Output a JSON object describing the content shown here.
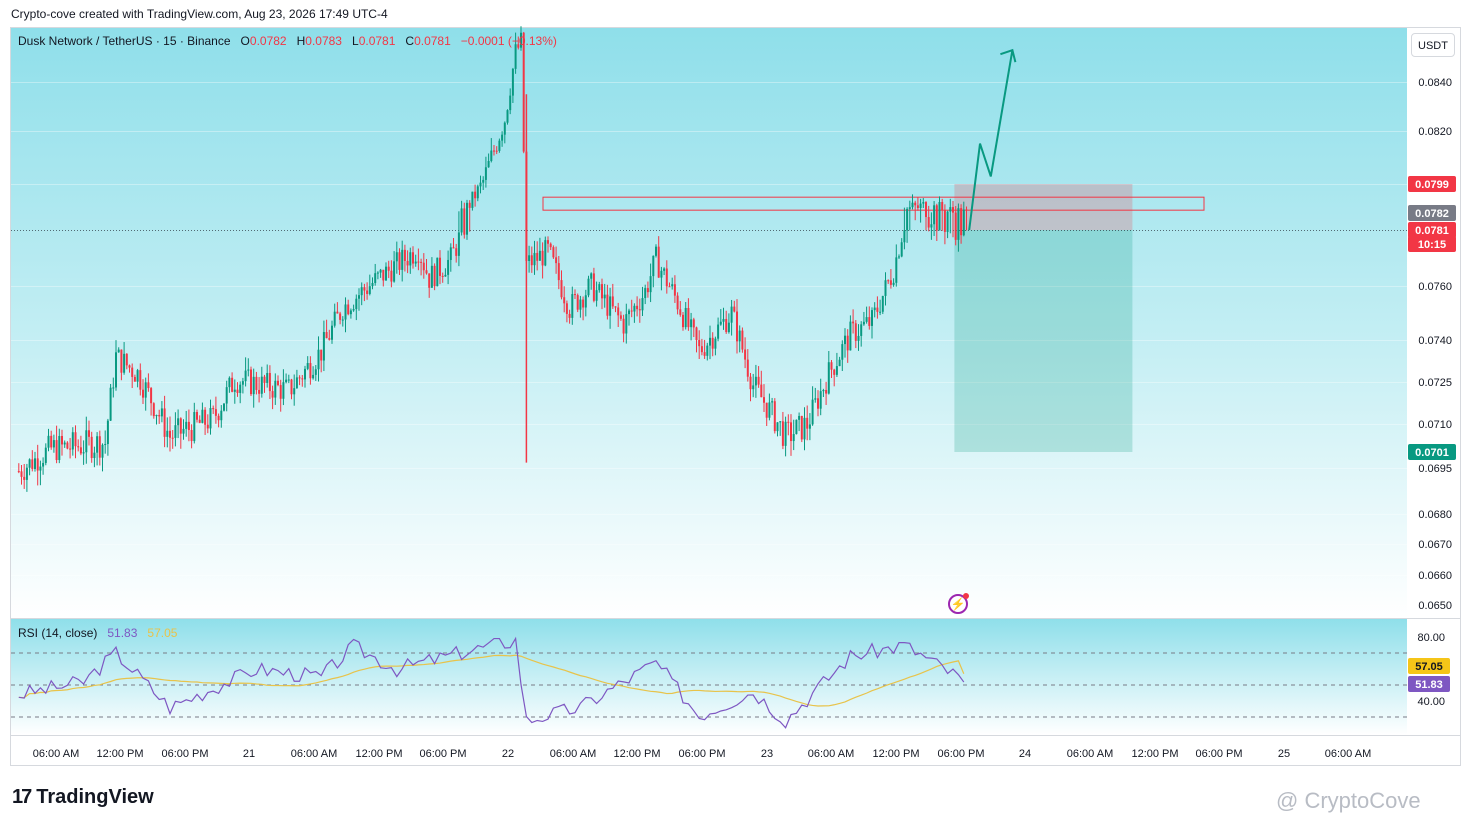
{
  "header": {
    "caption": "Crypto-cove created with TradingView.com, Aug 23, 2026 17:49 UTC-4"
  },
  "legend": {
    "symbol": "Dusk Network / TetherUS · 15 · Binance",
    "o_label": "O",
    "o": "0.0782",
    "h_label": "H",
    "h": "0.0783",
    "l_label": "L",
    "l": "0.0781",
    "c_label": "C",
    "c": "0.0781",
    "change": "−0.0001 (−0.13%)"
  },
  "currency_button": "USDT",
  "price_axis": {
    "ticks": [
      "0.0840",
      "0.0820",
      "0.0760",
      "0.0740",
      "0.0725",
      "0.0710",
      "0.0695",
      "0.0680",
      "0.0670",
      "0.0660",
      "0.0650"
    ],
    "tags": [
      {
        "label": "0.0799",
        "color": "#f23645"
      },
      {
        "label": "0.0782",
        "color": "#787b86"
      },
      {
        "label": "0.0781",
        "color": "#f23645"
      },
      {
        "label": "10:15",
        "color": "#f23645"
      },
      {
        "label": "0.0701",
        "color": "#089981"
      }
    ]
  },
  "rsi": {
    "title": "RSI (14, close)",
    "value": "51.83",
    "ma": "57.05",
    "ticks": [
      "80.00",
      "40.00"
    ],
    "tags": [
      {
        "label": "57.05",
        "color": "#f5c518"
      },
      {
        "label": "51.83",
        "color": "#7e57c2"
      }
    ]
  },
  "time_axis": {
    "labels": [
      "06:00 AM",
      "12:00 PM",
      "06:00 PM",
      "21",
      "06:00 AM",
      "12:00 PM",
      "06:00 PM",
      "22",
      "06:00 AM",
      "12:00 PM",
      "06:00 PM",
      "23",
      "06:00 AM",
      "12:00 PM",
      "06:00 PM",
      "24",
      "06:00 AM",
      "12:00 PM",
      "06:00 PM",
      "25",
      "06:00 AM"
    ]
  },
  "colors": {
    "up": "#089981",
    "down": "#f23645",
    "rsi": "#7e57c2",
    "rsi_ma": "#e8c34a",
    "bg_top": "#8fdfea",
    "bg_bottom": "#ffffff"
  },
  "brand": {
    "name": "TradingView",
    "logo": "17"
  },
  "watermark": "@ CryptoCove",
  "chart_data": {
    "type": "candlestick",
    "symbol": "Dusk Network / TetherUS",
    "interval": "15",
    "exchange": "Binance",
    "y_axis": "price (USDT)",
    "ylim": [
      0.0645,
      0.0862
    ],
    "last_price": 0.0781,
    "keypoints": [
      {
        "time": "Aug 20 02:00",
        "price": 0.0694
      },
      {
        "time": "Aug 20 05:00",
        "price": 0.0702
      },
      {
        "time": "Aug 20 10:00",
        "price": 0.0704
      },
      {
        "time": "Aug 20 11:00",
        "price": 0.0734
      },
      {
        "time": "Aug 20 13:00",
        "price": 0.0728
      },
      {
        "time": "Aug 20 16:00",
        "price": 0.0706
      },
      {
        "time": "Aug 20 20:00",
        "price": 0.0712
      },
      {
        "time": "Aug 20 22:00",
        "price": 0.0726
      },
      {
        "time": "Aug 21 03:00",
        "price": 0.0722
      },
      {
        "time": "Aug 21 06:00",
        "price": 0.0736
      },
      {
        "time": "Aug 21 08:00",
        "price": 0.0752
      },
      {
        "time": "Aug 21 11:00",
        "price": 0.0762
      },
      {
        "time": "Aug 21 15:00",
        "price": 0.0774
      },
      {
        "time": "Aug 21 16:00",
        "price": 0.0763
      },
      {
        "time": "Aug 21 18:00",
        "price": 0.077
      },
      {
        "time": "Aug 21 21:00",
        "price": 0.08
      },
      {
        "time": "Aug 21 23:00",
        "price": 0.0825
      },
      {
        "time": "Aug 22 00:00",
        "price": 0.0852
      },
      {
        "time": "Aug 22 00:30",
        "price": 0.0856
      },
      {
        "time": "Aug 22 01:00",
        "price": 0.0768
      },
      {
        "time": "Aug 22 03:00",
        "price": 0.0773
      },
      {
        "time": "Aug 22 05:00",
        "price": 0.0752
      },
      {
        "time": "Aug 22 07:00",
        "price": 0.076
      },
      {
        "time": "Aug 22 10:00",
        "price": 0.0746
      },
      {
        "time": "Aug 22 12:00",
        "price": 0.0758
      },
      {
        "time": "Aug 22 13:00",
        "price": 0.077
      },
      {
        "time": "Aug 22 15:00",
        "price": 0.0754
      },
      {
        "time": "Aug 22 17:00",
        "price": 0.0736
      },
      {
        "time": "Aug 22 20:00",
        "price": 0.075
      },
      {
        "time": "Aug 22 22:00",
        "price": 0.0724
      },
      {
        "time": "Aug 23 01:00",
        "price": 0.0706
      },
      {
        "time": "Aug 23 03:00",
        "price": 0.071
      },
      {
        "time": "Aug 23 05:00",
        "price": 0.0728
      },
      {
        "time": "Aug 23 07:00",
        "price": 0.0742
      },
      {
        "time": "Aug 23 09:00",
        "price": 0.0747
      },
      {
        "time": "Aug 23 11:00",
        "price": 0.0766
      },
      {
        "time": "Aug 23 12:00",
        "price": 0.0784
      },
      {
        "time": "Aug 23 14:00",
        "price": 0.0786
      },
      {
        "time": "Aug 23 16:00",
        "price": 0.0783
      },
      {
        "time": "Aug 23 17:45",
        "price": 0.0781
      }
    ],
    "resistance_zone": [
      0.0782,
      0.0786
    ],
    "position": {
      "entry": 0.0781,
      "target": 0.0799,
      "stop": 0.0701
    },
    "projection": [
      {
        "time": "Aug 23 18:00",
        "price": 0.0781
      },
      {
        "time": "Aug 23 19:00",
        "price": 0.0815
      },
      {
        "time": "Aug 23 20:00",
        "price": 0.0802
      },
      {
        "time": "Aug 23 22:00",
        "price": 0.0853
      }
    ],
    "rsi_series": {
      "name": "RSI (14, close)",
      "ylim": [
        30,
        88
      ],
      "levels": [
        70,
        50,
        30
      ],
      "keypoints": [
        {
          "time": "Aug 20 02:00",
          "rsi": 44
        },
        {
          "time": "Aug 20 08:00",
          "rsi": 52
        },
        {
          "time": "Aug 20 11:00",
          "rsi": 70
        },
        {
          "time": "Aug 20 16:00",
          "rsi": 36
        },
        {
          "time": "Aug 21 00:00",
          "rsi": 60
        },
        {
          "time": "Aug 21 06:00",
          "rsi": 55
        },
        {
          "time": "Aug 21 09:00",
          "rsi": 74
        },
        {
          "time": "Aug 21 13:00",
          "rsi": 60
        },
        {
          "time": "Aug 21 20:00",
          "rsi": 72
        },
        {
          "time": "Aug 22 00:00",
          "rsi": 78
        },
        {
          "time": "Aug 22 01:00",
          "rsi": 28
        },
        {
          "time": "Aug 22 06:00",
          "rsi": 36
        },
        {
          "time": "Aug 22 13:00",
          "rsi": 64
        },
        {
          "time": "Aug 22 17:00",
          "rsi": 31
        },
        {
          "time": "Aug 22 22:00",
          "rsi": 46
        },
        {
          "time": "Aug 23 01:00",
          "rsi": 28
        },
        {
          "time": "Aug 23 07:00",
          "rsi": 68
        },
        {
          "time": "Aug 23 12:00",
          "rsi": 75
        },
        {
          "time": "Aug 23 17:45",
          "rsi": 51.83
        }
      ],
      "ma_last": 57.05
    }
  }
}
